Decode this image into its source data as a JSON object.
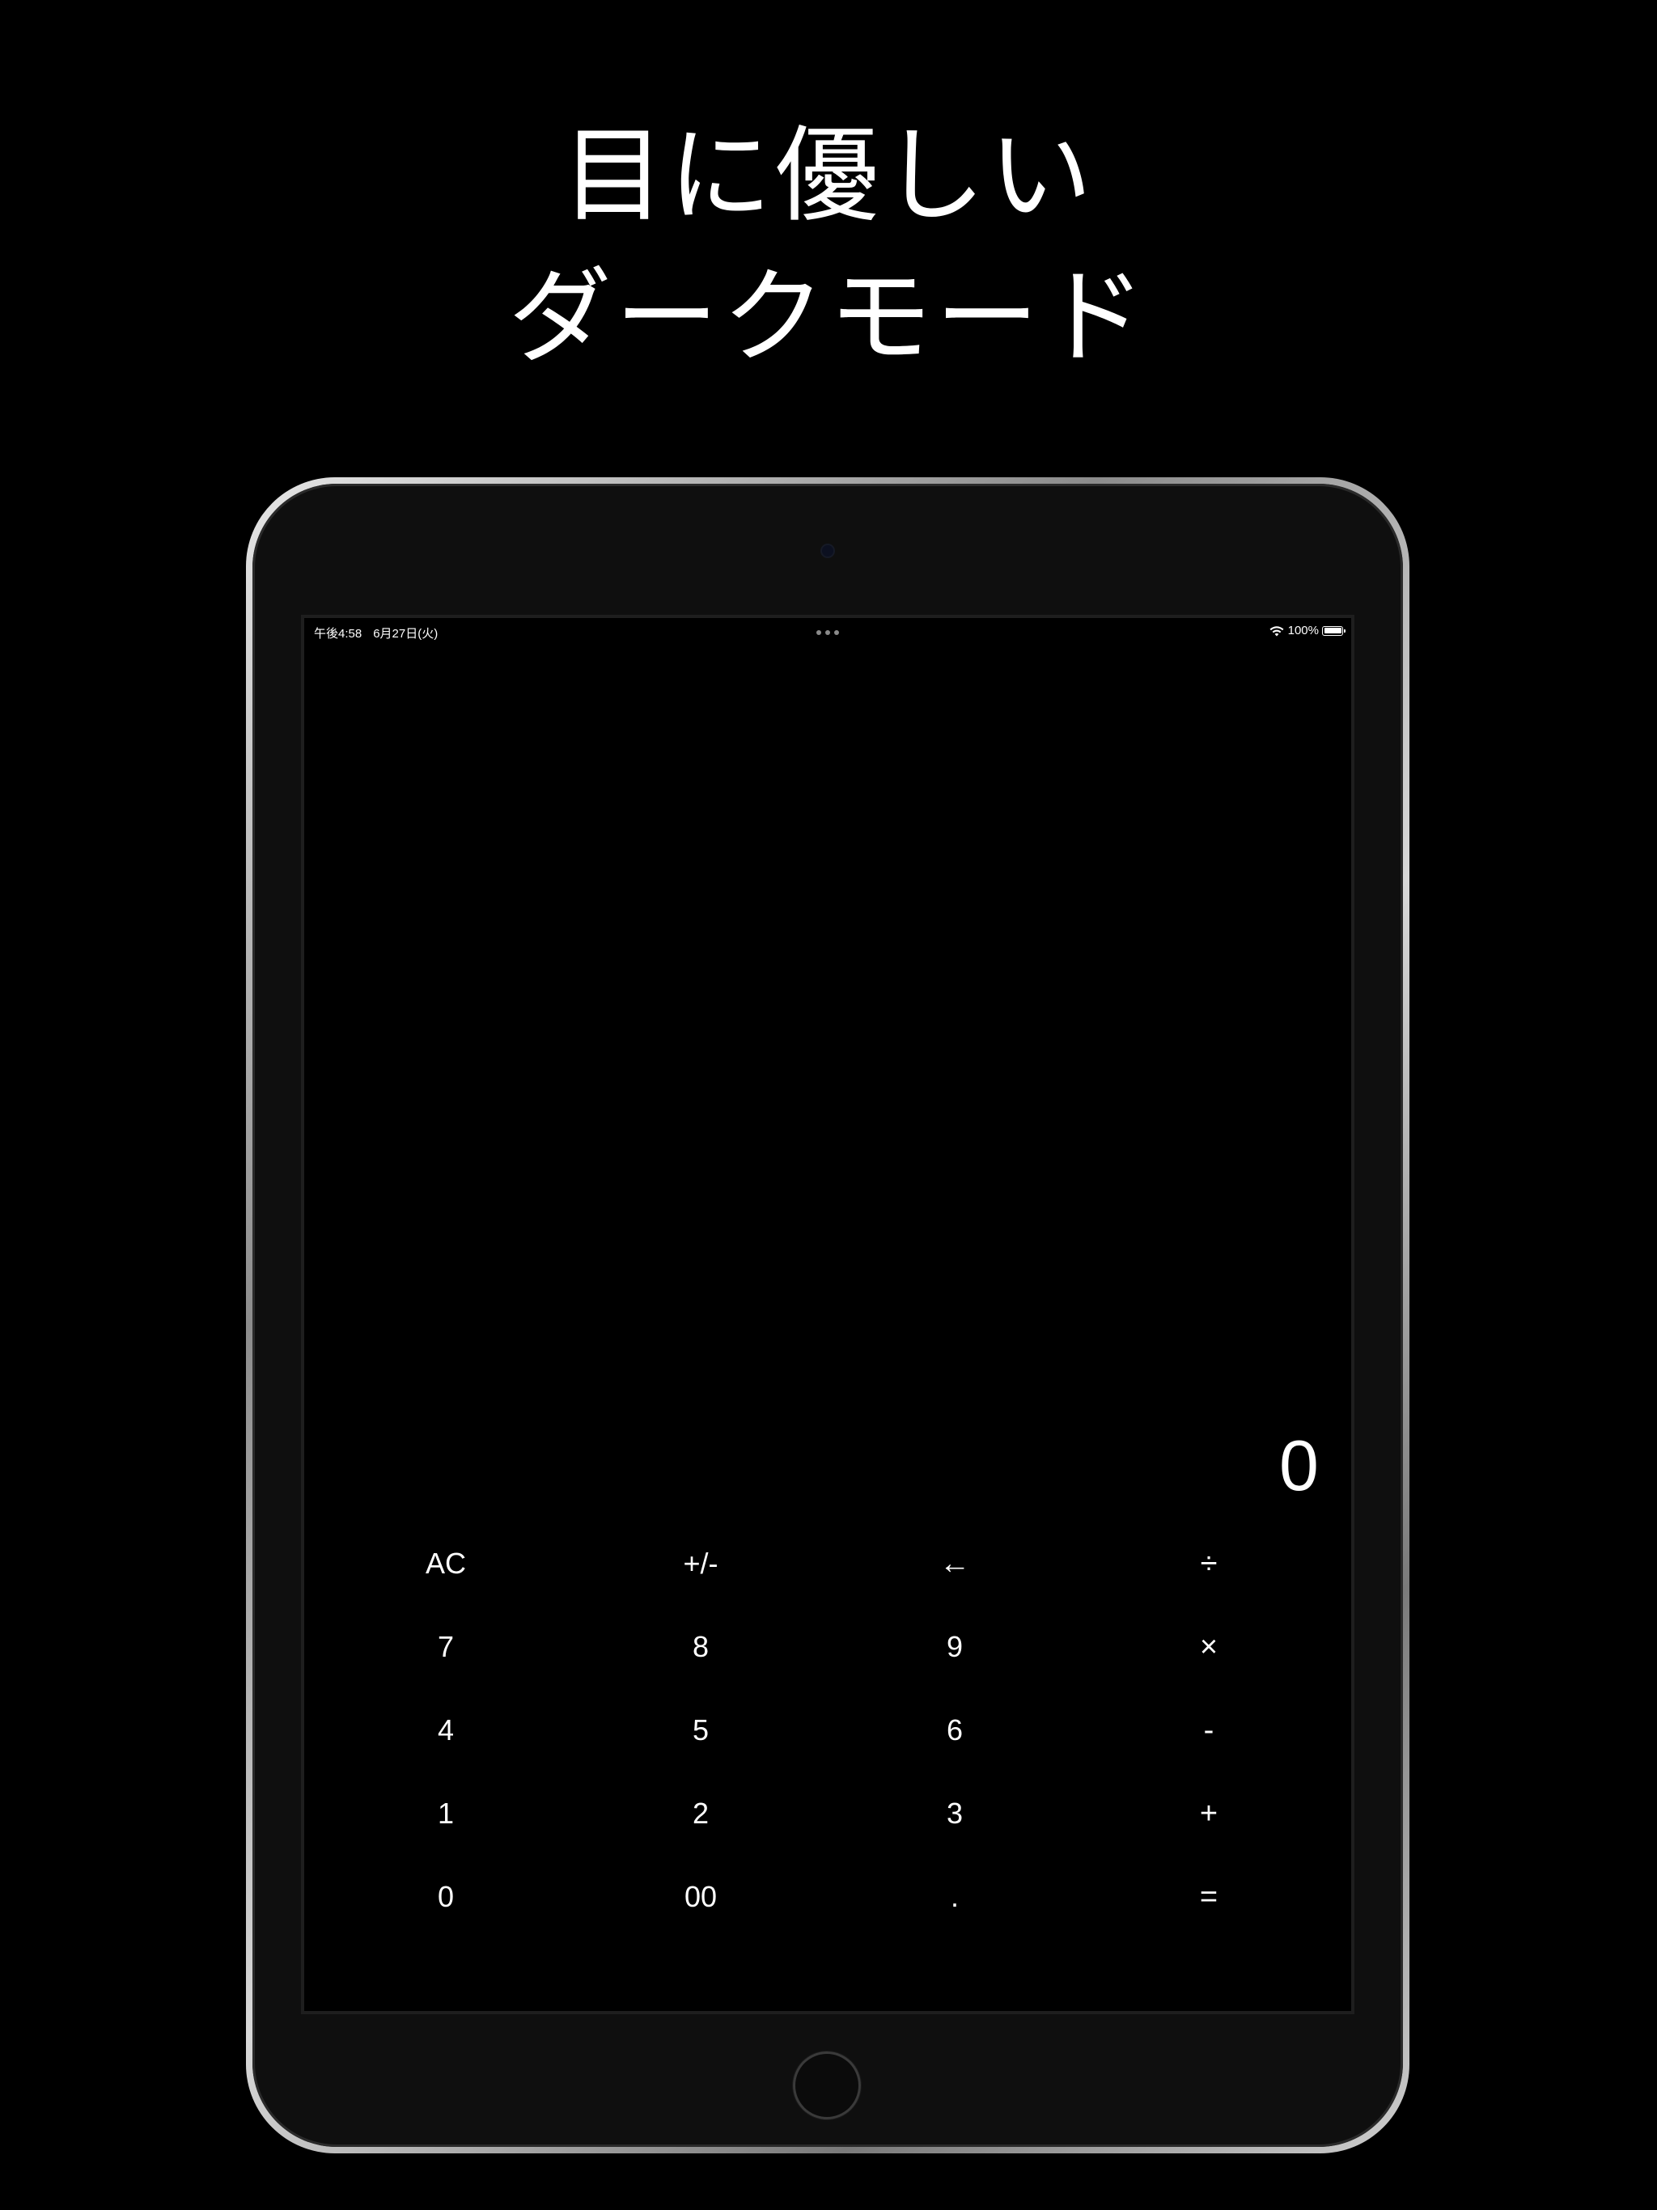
{
  "headline": {
    "line1": "目に優しい",
    "line2": "ダークモード"
  },
  "status_bar": {
    "time": "午後4:58",
    "date": "6月27日(火)",
    "battery": "100%"
  },
  "calculator": {
    "display": "0",
    "rows": [
      [
        "AC",
        "+/-",
        "←",
        "÷"
      ],
      [
        "7",
        "8",
        "9",
        "×"
      ],
      [
        "4",
        "5",
        "6",
        "-"
      ],
      [
        "1",
        "2",
        "3",
        "+"
      ],
      [
        "0",
        "00",
        ".",
        "="
      ]
    ]
  },
  "icons": [
    "wifi-icon",
    "battery-icon",
    "camera-icon",
    "home-button-icon",
    "more-dots-icon"
  ]
}
